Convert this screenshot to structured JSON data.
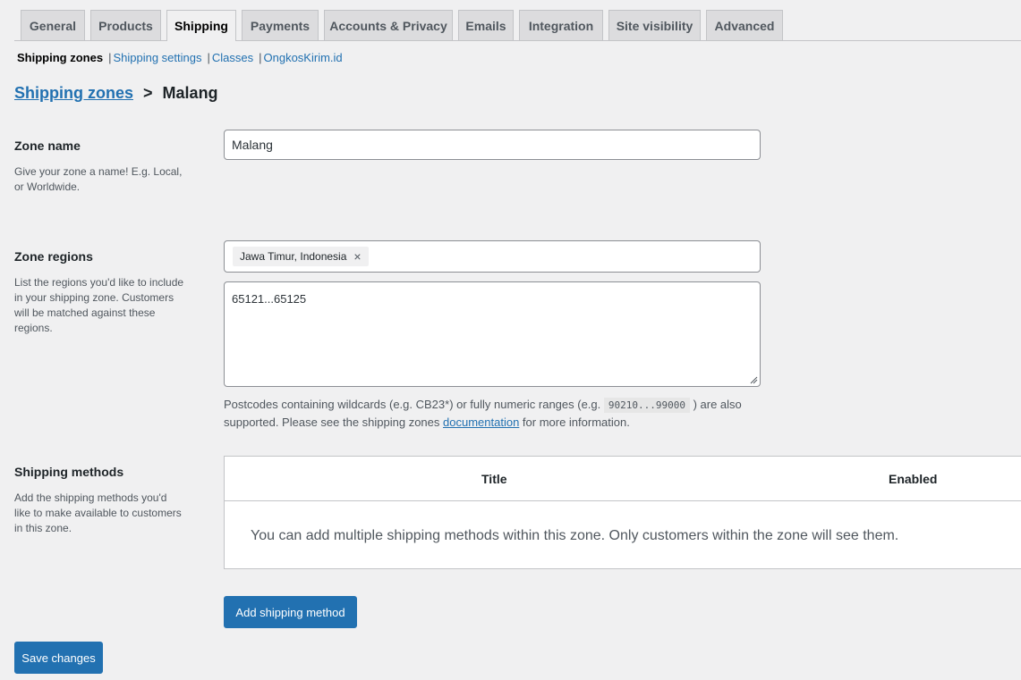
{
  "tabs": [
    {
      "label": "General",
      "active": false
    },
    {
      "label": "Products",
      "active": false
    },
    {
      "label": "Shipping",
      "active": true
    },
    {
      "label": "Payments",
      "active": false
    },
    {
      "label": "Accounts & Privacy",
      "active": false
    },
    {
      "label": "Emails",
      "active": false
    },
    {
      "label": "Integration",
      "active": false
    },
    {
      "label": "Site visibility",
      "active": false
    },
    {
      "label": "Advanced",
      "active": false
    }
  ],
  "subnav": {
    "current": "Shipping zones",
    "links": [
      "Shipping settings",
      "Classes",
      "OngkosKirim.id"
    ],
    "separator": "|"
  },
  "breadcrumb": {
    "link": "Shipping zones",
    "separator": ">",
    "current": "Malang"
  },
  "zone_name": {
    "label": "Zone name",
    "description": "Give your zone a name! E.g. Local, or Worldwide.",
    "value": "Malang"
  },
  "zone_regions": {
    "label": "Zone regions",
    "description": "List the regions you'd like to include in your shipping zone. Customers will be matched against these regions.",
    "chip": "Jawa Timur, Indonesia",
    "chip_remove": "×",
    "postcodes": "65121...65125",
    "help_before": "Postcodes containing wildcards (e.g. CB23*) or fully numeric ranges (e.g. ",
    "help_code": "90210...99000",
    "help_middle": " ) are also supported. Please see the shipping zones ",
    "help_link": "documentation",
    "help_after": " for more information."
  },
  "shipping_methods": {
    "label": "Shipping methods",
    "description": "Add the shipping methods you'd like to make available to customers in this zone.",
    "col_title": "Title",
    "col_enabled": "Enabled",
    "empty_message": "You can add multiple shipping methods within this zone. Only customers within the zone will see them.",
    "add_button": "Add shipping method"
  },
  "save_button": "Save changes",
  "colors": {
    "accent": "#2271b1",
    "background": "#f0f0f1",
    "tab_bg": "#dcdcde"
  }
}
